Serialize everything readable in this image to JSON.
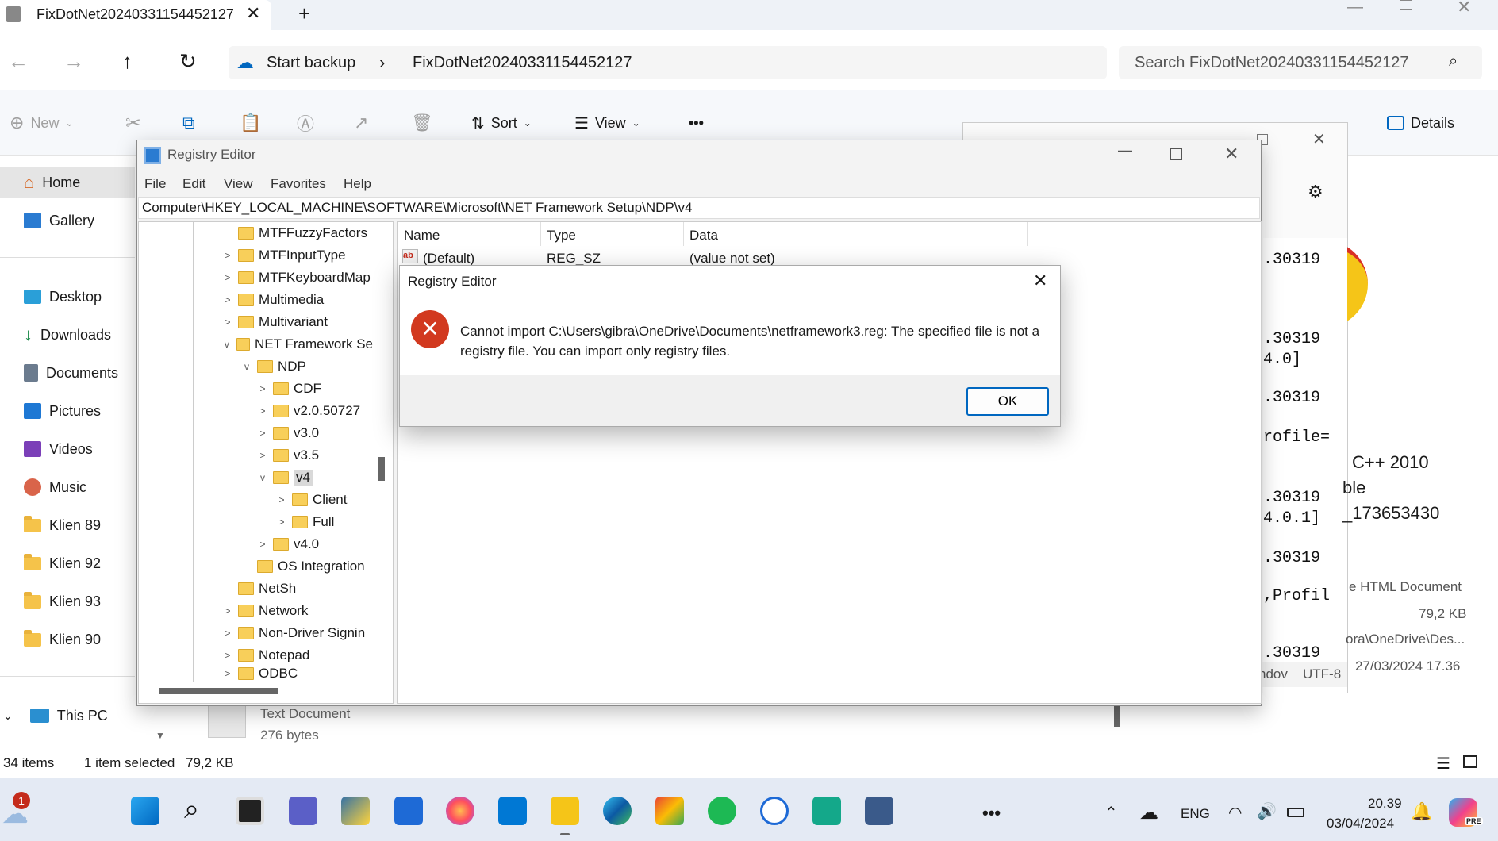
{
  "explorer": {
    "tab_title": "FixDotNet20240331154452127",
    "breadcrumb_start": "Start backup",
    "breadcrumb_folder": "FixDotNet20240331154452127",
    "search_placeholder": "Search FixDotNet20240331154452127",
    "cmd": {
      "new": "New",
      "sort": "Sort",
      "view": "View",
      "more": "•••",
      "details": "Details"
    },
    "sidebar": [
      "Home",
      "Gallery",
      "Desktop",
      "Downloads",
      "Documents",
      "Pictures",
      "Videos",
      "Music",
      "Klien 89",
      "Klien 92",
      "Klien 93",
      "Klien 90",
      "This PC"
    ],
    "file_type": "Text Document",
    "file_size": "276 bytes",
    "status": {
      "items": "34 items",
      "selected": "1 item selected",
      "size": "79,2 KB"
    }
  },
  "right_panel": {
    "lines": [
      ".30319",
      ".30319",
      "4.0]",
      ".30319",
      "rofile=",
      ".30319",
      "4.0.1]",
      ".30319",
      ",Profil",
      ".30319"
    ],
    "heading": [
      "C++ 2010",
      "ble",
      "_173653430"
    ],
    "props": [
      "e HTML Document",
      "79,2 KB",
      "ora\\OneDrive\\Des...",
      "27/03/2024 17.36"
    ],
    "encoding": [
      "ndov",
      "UTF-8"
    ]
  },
  "regedit": {
    "title": "Registry Editor",
    "menu": [
      "File",
      "Edit",
      "View",
      "Favorites",
      "Help"
    ],
    "path": "Computer\\HKEY_LOCAL_MACHINE\\SOFTWARE\\Microsoft\\NET Framework Setup\\NDP\\v4",
    "tree": [
      "MTFFuzzyFactors",
      "MTFInputType",
      "MTFKeyboardMap",
      "Multimedia",
      "Multivariant",
      "NET Framework Se",
      "NDP",
      "CDF",
      "v2.0.50727",
      "v3.0",
      "v3.5",
      "v4",
      "Client",
      "Full",
      "v4.0",
      "OS Integration",
      "NetSh",
      "Network",
      "Non-Driver Signin",
      "Notepad",
      "ODBC"
    ],
    "columns": [
      "Name",
      "Type",
      "Data"
    ],
    "row": {
      "name": "(Default)",
      "type": "REG_SZ",
      "data": "(value not set)"
    }
  },
  "dialog": {
    "title": "Registry Editor",
    "message": "Cannot import C:\\Users\\gibra\\OneDrive\\Documents\\netframework3.reg: The specified file is not a registry file. You can import only registry files.",
    "ok": "OK"
  },
  "taskbar": {
    "badge": "1",
    "lang": "ENG",
    "time": "20.39",
    "date": "03/04/2024",
    "pre": "PRE"
  },
  "colors": {
    "accent": "#0067c0",
    "error": "#c42b1c",
    "folder": "#f8cf5a"
  }
}
